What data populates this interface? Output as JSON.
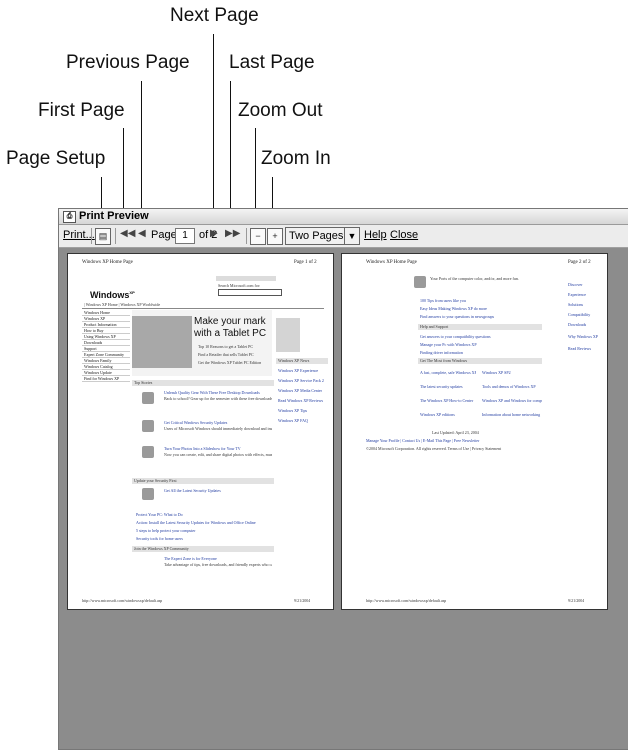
{
  "callouts": {
    "next_page": "Next Page",
    "previous_page": "Previous Page",
    "last_page": "Last Page",
    "first_page": "First Page",
    "zoom_out": "Zoom Out",
    "page_setup": "Page Setup",
    "zoom_in": "Zoom In"
  },
  "window": {
    "title": "Print Preview"
  },
  "toolbar": {
    "print_label": "Print...",
    "page_label": "Page",
    "page_number": "1",
    "page_of": "of 2",
    "zoom_value": "Two Pages",
    "help_label": "Help",
    "close_label": "Close"
  },
  "page1": {
    "header_left": "Windows XP Home Page",
    "header_right": "Page 1 of 2",
    "logo_text": "Windows",
    "logo_sup": "XP",
    "breadcrumb": "| Windows XP Home | Windows XP Worldwide",
    "search_label": "Search Microsoft.com for:",
    "nav": [
      "Windows Home",
      "Windows XP",
      "Product Information",
      "How to Buy",
      "Using Windows XP",
      "Downloads",
      "Support",
      "Expert Zone Community",
      "Windows Family",
      "Windows Catalog",
      "Windows Update",
      "Find for Windows XP"
    ],
    "banner_title": "Make your mark",
    "banner_subtitle": "with a Tablet PC",
    "banner_items": [
      "Top 10 Reasons to get a Tablet PC",
      "Find a Retailer that sells Tablet PC",
      "Get the Windows XP Tablet PC Edition"
    ],
    "top_stories_heading": "Top Stories",
    "stories": [
      {
        "title": "Unleash Quality Gear With These Free Desktop Downloads",
        "body": "Back to school? Gear up for the semester with these free downloads."
      },
      {
        "title": "Get Critical Windows Security Updates",
        "body": "Users of Microsoft Windows should immediately download and install new security updates."
      },
      {
        "title": "Turn Your Photos Into a Slideshow for Your TV",
        "body": "Now you can create, edit, and share digital photos with effects, music, and narration."
      }
    ],
    "security_heading": "Update your Security First",
    "security_title": "Get All the Latest Security Updates",
    "links": [
      "Protect Your PC: What to Do",
      "Action: Install the Latest Security Updates for Windows and Office Online",
      "5 steps to help protect your computer",
      "Security tools for home users"
    ],
    "community_heading": "Join the Windows XP Community",
    "community_title": "The Expert Zone is for Everyone",
    "community_body": "Take advantage of tips, free downloads, and friendly experts who can answer your questions and more.",
    "side_heading": "Windows XP News",
    "side_links": [
      "Windows XP Experience",
      "Windows XP Service Pack 2",
      "Windows XP Media Center",
      "Read Windows XP Reviews",
      "Windows XP Tips",
      "Windows XP FAQ"
    ],
    "footer_left": "http://www.microsoft.com/windowsxp/default.asp",
    "footer_right": "9/21/2004"
  },
  "page2": {
    "header_left": "Windows XP Home Page",
    "header_right": "Page 2 of 2",
    "intro": "Your Ports of the computer color, and/or, and more fun.",
    "links": [
      "100 Tips from users like you",
      "Easy Ideas Making Windows XP do more",
      "Find answers to your questions in newsgroups",
      "Get answers to your compatibility questions",
      "Manage your Pc with Windows XP",
      "Finding driver information"
    ],
    "heading_a": "Help and Support",
    "heading_b": "Get The Most from Windows",
    "col1": [
      "A fast, complete, safe Windows XP",
      "The latest security updates",
      "The Windows XP How-to Center",
      "Windows XP editions"
    ],
    "col2": [
      "Windows XP SP2",
      "Tools and demos of Windows XP",
      "Windows XP and Windows for computers",
      "Information about home networking"
    ],
    "updated": "Last Updated: April 23, 2004",
    "footer_links": "Manage Your Profile | Contact Us | E-Mail This Page | Free Newsletter",
    "copyright": "©2004 Microsoft Corporation. All rights reserved. Terms of Use | Privacy Statement",
    "side_links": [
      "Discover",
      "Experience",
      "Solutions",
      "Compatibility",
      "Downloads",
      "Why Windows XP",
      "Read Reviews"
    ],
    "footer_left": "http://www.microsoft.com/windowsxp/default.asp",
    "footer_right": "9/21/2004"
  }
}
